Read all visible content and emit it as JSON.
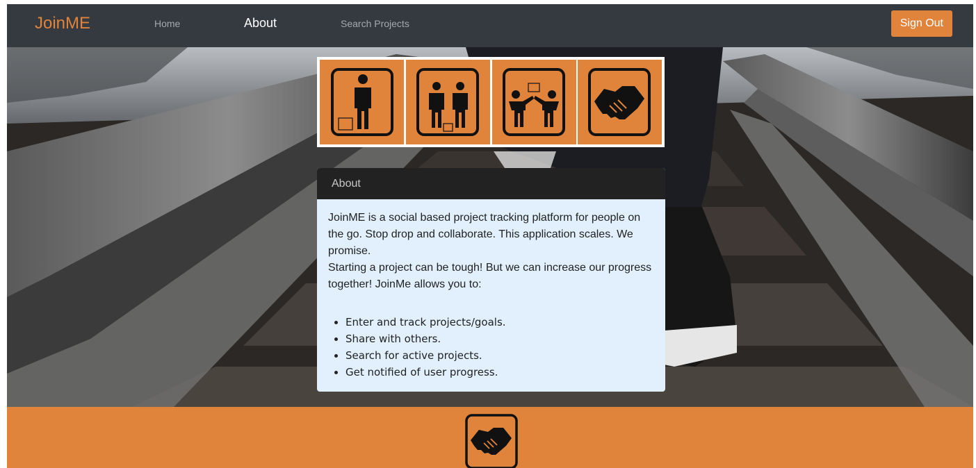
{
  "navbar": {
    "brand": "JoinME",
    "links": [
      {
        "label": "Home",
        "active": false
      },
      {
        "label": "About",
        "active": true
      },
      {
        "label": "Search Projects",
        "active": false
      }
    ],
    "sign_out_label": "Sign Out"
  },
  "logo": {
    "tiles": [
      "person-icon",
      "two-people-icon",
      "people-sharing-icon",
      "handshake-icon"
    ]
  },
  "about_card": {
    "header": "About",
    "paragraph_1": "JoinME is a social based project tracking platform for people on the go. Stop drop and collaborate. This application scales. We promise.",
    "paragraph_2": "Starting a project can be tough! But we can increase our progress together! JoinMe allows you to:",
    "features": [
      "Enter and track projects/goals.",
      "Share with others.",
      "Search for active projects.",
      "Get notified of user progress."
    ]
  },
  "footer": {
    "icon": "handshake-icon"
  },
  "colors": {
    "accent": "#e0843c",
    "navbar": "#343a40",
    "card_header": "#222222",
    "card_body": "#e1f0fc"
  }
}
